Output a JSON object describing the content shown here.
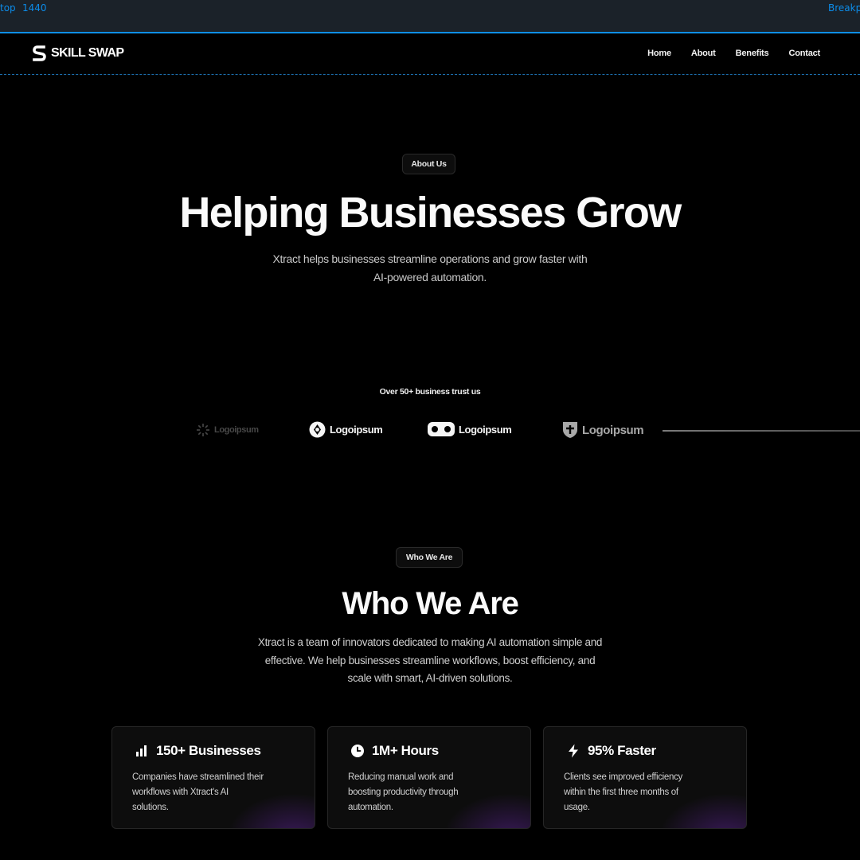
{
  "editor": {
    "breakpoint_left": "top",
    "breakpoint_width": "1440",
    "breakpoint_right": "Breakpoint"
  },
  "nav": {
    "brand": "SKILL SWAP",
    "links": [
      "Home",
      "About",
      "Benefits",
      "Contact"
    ]
  },
  "hero": {
    "badge": "About Us",
    "title": "Helping Businesses Grow",
    "subtitle_line1": "Xtract helps businesses streamline operations and grow faster with",
    "subtitle_line2": "AI-powered automation."
  },
  "trust": {
    "text": "Over 50+ business trust us",
    "logos": [
      "Logoipsum",
      "Logoipsum",
      "Logoipsum",
      "Logoipsum"
    ]
  },
  "who": {
    "badge": "Who We Are",
    "title": "Who We Are",
    "line1": "Xtract is a team of innovators dedicated to making AI automation simple and",
    "line2": "effective. We help businesses streamline workflows, boost efficiency, and",
    "line3": "scale with smart, AI-driven solutions."
  },
  "cards": [
    {
      "icon": "bar-chart-icon",
      "title": "150+ Businesses",
      "desc_lines": [
        "Companies have streamlined their",
        "workflows with Xtract's AI",
        "solutions."
      ]
    },
    {
      "icon": "clock-icon",
      "title": "1M+ Hours",
      "desc_lines": [
        "Reducing manual work and",
        "boosting productivity through",
        "automation."
      ]
    },
    {
      "icon": "lightning-icon",
      "title": "95% Faster",
      "desc_lines": [
        "Clients see improved efficiency",
        "within the first three months of",
        "usage."
      ]
    }
  ]
}
